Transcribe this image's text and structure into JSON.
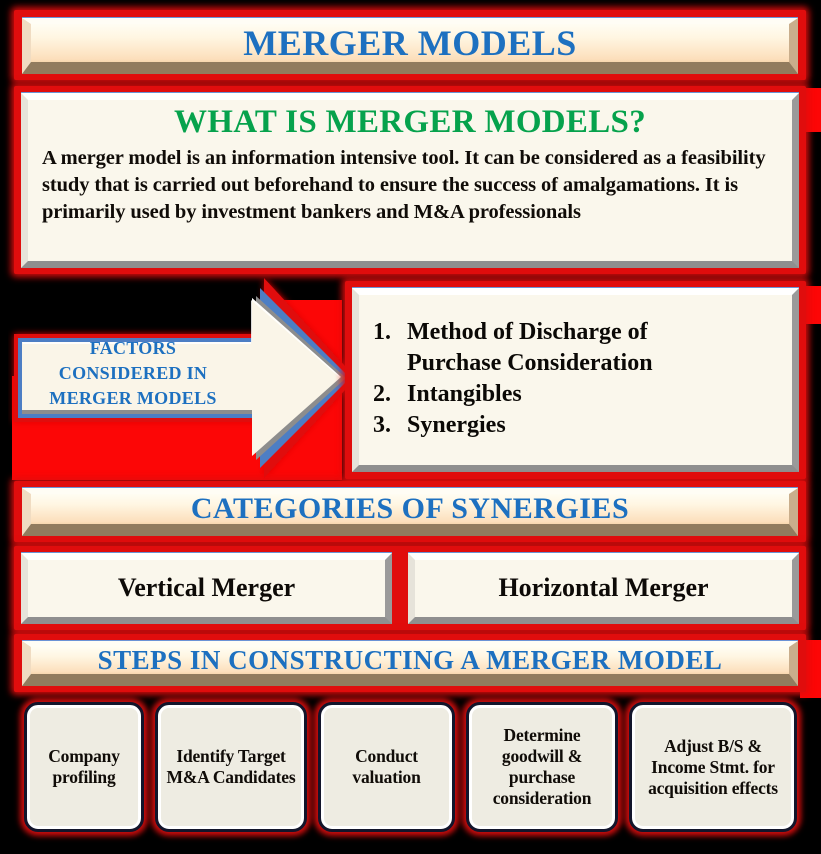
{
  "colors": {
    "frame_red": "#e00d0d",
    "accent_blue": "#1d70c0",
    "heading_green": "#06a24c",
    "plate_cream": "#faf7ec",
    "banner_peach": "#fcdfbc",
    "bevel_brown": "#917b5e",
    "chip_border_navy": "#12152b",
    "background": "#000000"
  },
  "title_banner": {
    "text": "MERGER MODELS"
  },
  "definition_section": {
    "heading": "WHAT IS MERGER MODELS?",
    "body": "A merger model is an information intensive tool. It can be considered as a feasibility study that is carried out beforehand to ensure the success of amalgamations. It is primarily used by investment bankers and M&A professionals"
  },
  "factors_arrow": {
    "line1": "FACTORS",
    "line2": "CONSIDERED IN",
    "line3": "MERGER MODELS"
  },
  "factors_list": {
    "items": [
      {
        "number": "1.",
        "label": "Method of Discharge of Purchase Consideration"
      },
      {
        "number": "2.",
        "label": "Intangibles"
      },
      {
        "number": "3.",
        "label": "Synergies"
      }
    ]
  },
  "synergies_banner": {
    "text": "CATEGORIES OF SYNERGIES"
  },
  "synergy_types": [
    {
      "label": "Vertical Merger"
    },
    {
      "label": "Horizontal Merger"
    }
  ],
  "steps_banner": {
    "text": "STEPS IN CONSTRUCTING A MERGER MODEL"
  },
  "steps": [
    {
      "label": "Company profiling"
    },
    {
      "label": "Identify Target M&A Candidates"
    },
    {
      "label": "Conduct valuation"
    },
    {
      "label": "Determine goodwill & purchase consideration"
    },
    {
      "label": "Adjust B/S & Income Stmt. for acquisition effects"
    }
  ]
}
